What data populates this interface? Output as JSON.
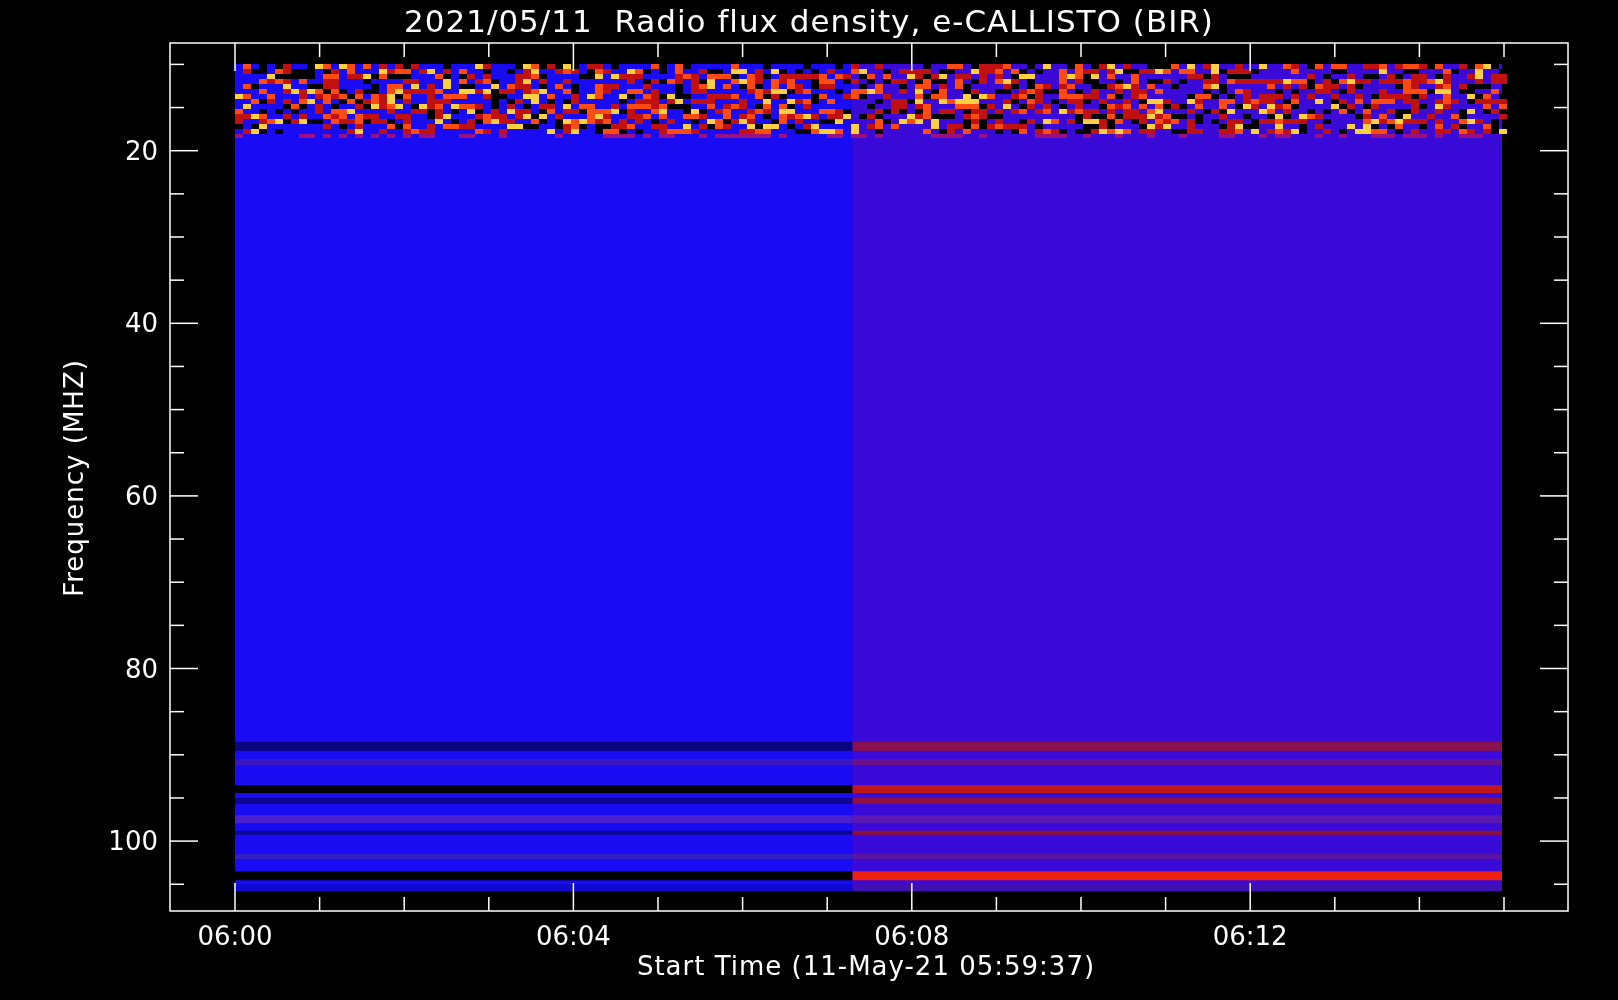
{
  "chart": {
    "title": "2021/05/11  Radio flux density, e-CALLISTO (BIR)",
    "y_axis": {
      "label": "Frequency (MHZ)",
      "ticks": [
        "20",
        "40",
        "60",
        "80",
        "100"
      ]
    },
    "x_axis": {
      "label": "Start Time (11-May-21 05:59:37)",
      "ticks": [
        "06:00",
        "06:04",
        "06:08",
        "06:12"
      ]
    }
  }
}
